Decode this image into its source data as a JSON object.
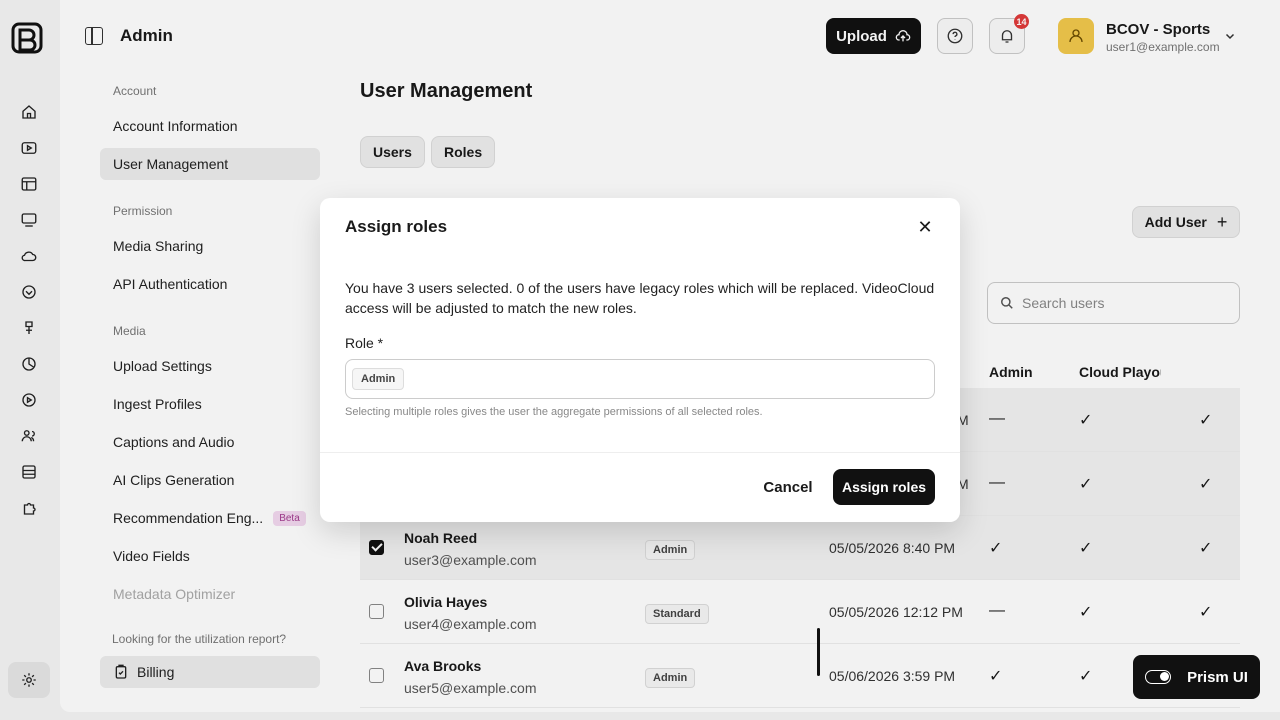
{
  "header": {
    "title": "Admin",
    "upload_label": "Upload",
    "notification_count": "14",
    "account_name": "BCOV - Sports",
    "account_email": "user1@example.com"
  },
  "sidebar": {
    "sections": [
      {
        "label": "Account",
        "items": [
          "Account Information",
          "User Management"
        ]
      },
      {
        "label": "Permission",
        "items": [
          "Media Sharing",
          "API Authentication"
        ]
      },
      {
        "label": "Media",
        "items": [
          "Upload Settings",
          "Ingest Profiles",
          "Captions and Audio",
          "AI Clips Generation",
          "Recommendation Eng...",
          "Video Fields",
          "Metadata Optimizer"
        ]
      }
    ],
    "beta_label": "Beta",
    "utilization_note": "Looking for the utilization report?",
    "billing_label": "Billing"
  },
  "page": {
    "title": "User Management",
    "tabs": [
      "Users",
      "Roles"
    ],
    "add_user_label": "Add User",
    "search_placeholder": "Search users",
    "columns": [
      "Admin",
      "Cloud Playou"
    ]
  },
  "rows": [
    {
      "name": "",
      "email": "",
      "role": "",
      "date": "M",
      "c1": "—",
      "c2": "✓",
      "c3": "✓",
      "checked": true
    },
    {
      "name": "",
      "email": "",
      "role": "",
      "date": "M",
      "c1": "—",
      "c2": "✓",
      "c3": "✓",
      "checked": true
    },
    {
      "name": "Noah Reed",
      "email": "user3@example.com",
      "role": "Admin",
      "date": "05/05/2026 8:40 PM",
      "c1": "✓",
      "c2": "✓",
      "c3": "✓",
      "checked": true
    },
    {
      "name": "Olivia Hayes",
      "email": "user4@example.com",
      "role": "Standard",
      "date": "05/05/2026 12:12 PM",
      "c1": "—",
      "c2": "✓",
      "c3": "✓",
      "checked": false
    },
    {
      "name": "Ava Brooks",
      "email": "user5@example.com",
      "role": "Admin",
      "date": "05/06/2026 3:59 PM",
      "c1": "✓",
      "c2": "✓",
      "c3": "",
      "checked": false
    }
  ],
  "modal": {
    "title": "Assign roles",
    "message": "You have 3 users selected. 0 of the users have legacy roles which will be replaced. VideoCloud access will be adjusted to match the new roles.",
    "role_label": "Role *",
    "selected_role": "Admin",
    "hint": "Selecting multiple roles gives the user the aggregate permissions of all selected roles.",
    "cancel_label": "Cancel",
    "submit_label": "Assign roles"
  },
  "prism": {
    "label": "Prism UI"
  }
}
